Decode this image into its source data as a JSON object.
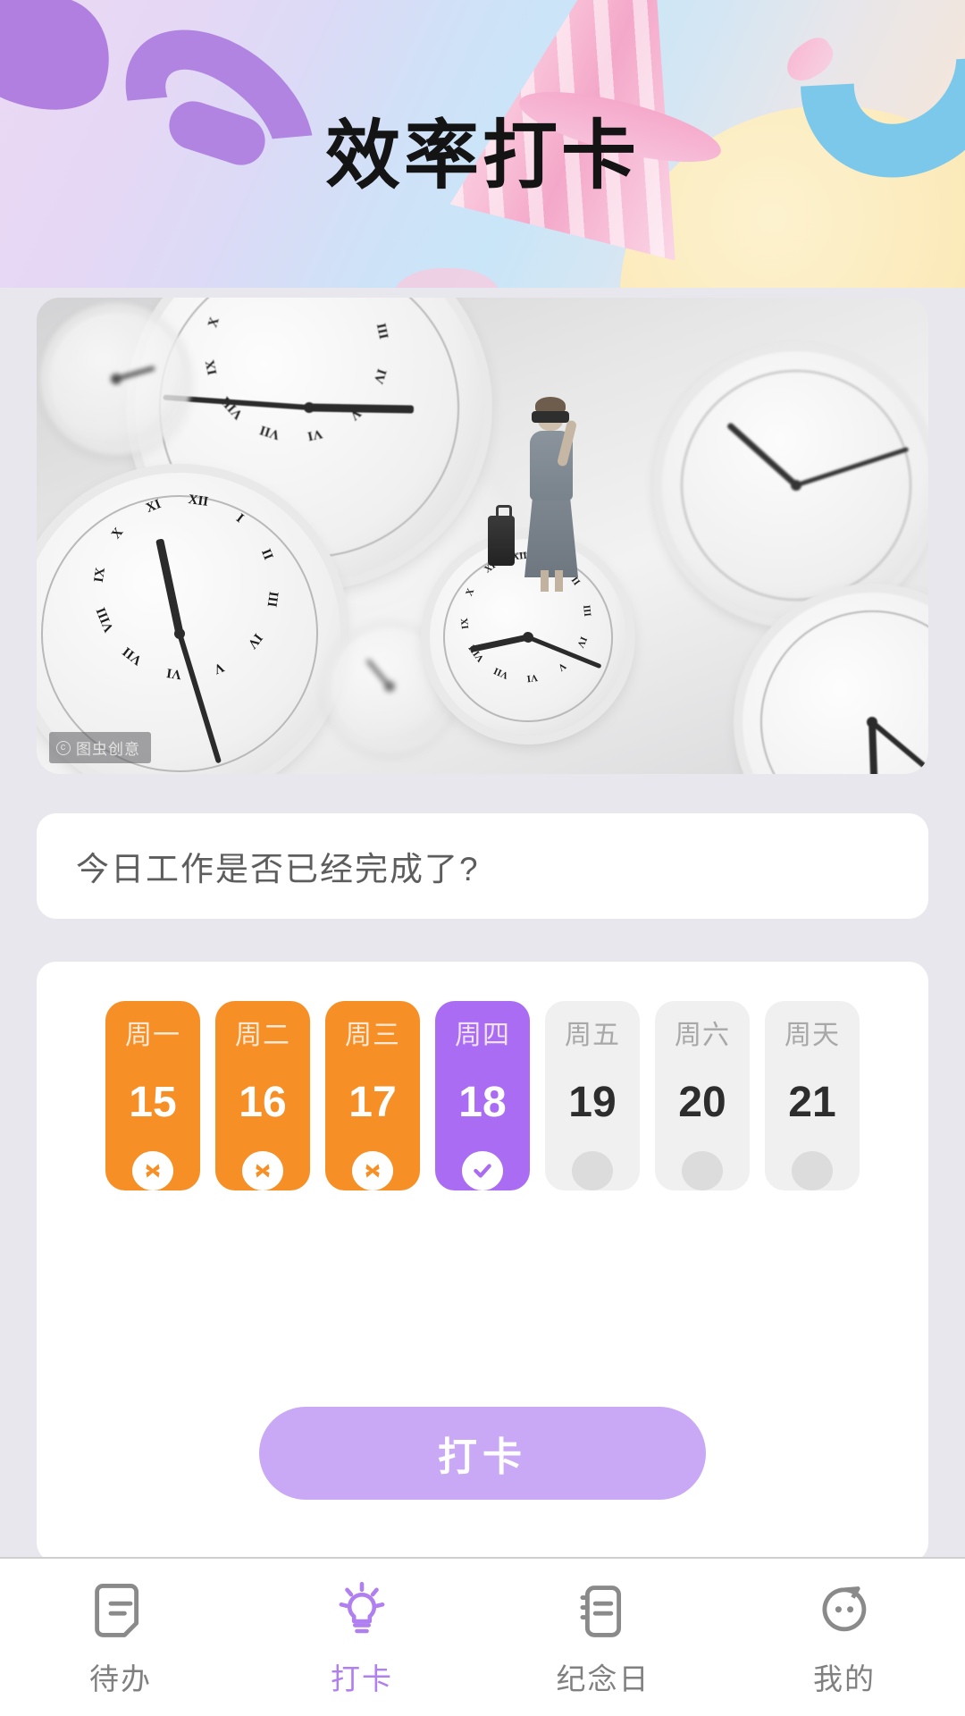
{
  "header": {
    "title": "效率打卡",
    "accent_purple": "#b07ff0",
    "accent_orange": "#f68f25",
    "background_gradient": "lavender-to-peach pastel"
  },
  "hero": {
    "alt": "blurred analog clocks with woman holding binoculars standing on a clock",
    "watermark": "图虫创意",
    "watermark_copyright": "c"
  },
  "question": {
    "text": "今日工作是否已经完成了?"
  },
  "week": {
    "days": [
      {
        "name": "周一",
        "date": "15",
        "state": "missed",
        "mark": "x-icon"
      },
      {
        "name": "周二",
        "date": "16",
        "state": "missed",
        "mark": "x-icon"
      },
      {
        "name": "周三",
        "date": "17",
        "state": "missed",
        "mark": "x-icon"
      },
      {
        "name": "周四",
        "date": "18",
        "state": "today",
        "mark": "check-icon"
      },
      {
        "name": "周五",
        "date": "19",
        "state": "future",
        "mark": "dot-icon"
      },
      {
        "name": "周六",
        "date": "20",
        "state": "future",
        "mark": "dot-icon"
      },
      {
        "name": "周天",
        "date": "21",
        "state": "future",
        "mark": "dot-icon"
      }
    ],
    "checkin_button": "打卡"
  },
  "tabbar": {
    "items": [
      {
        "label": "待办",
        "icon": "note-icon",
        "active": false
      },
      {
        "label": "打卡",
        "icon": "lightbulb-icon",
        "active": true
      },
      {
        "label": "纪念日",
        "icon": "notebook-icon",
        "active": false
      },
      {
        "label": "我的",
        "icon": "face-icon",
        "active": false
      }
    ],
    "active_color": "#b07ff0",
    "inactive_color": "#808080"
  }
}
